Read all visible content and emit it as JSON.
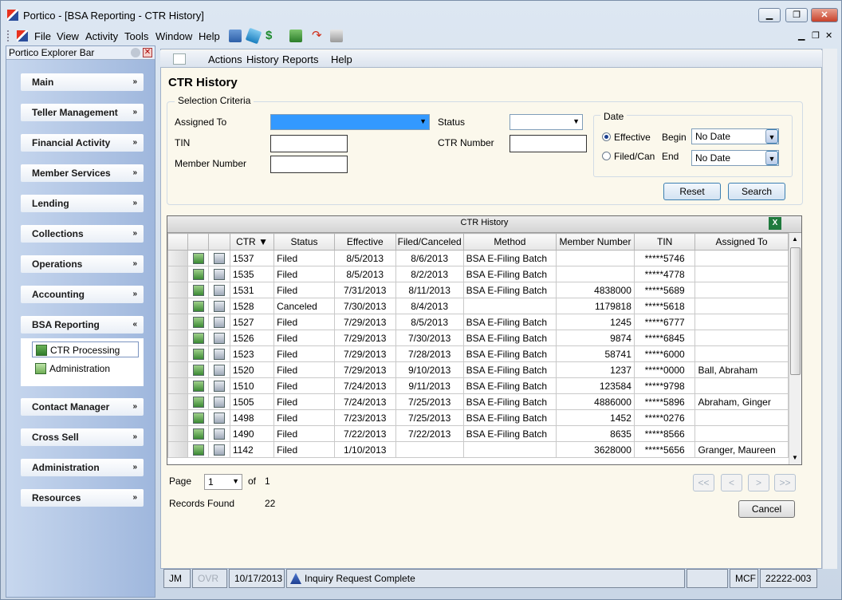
{
  "window": {
    "title": "Portico - [BSA Reporting - CTR History]"
  },
  "menu": [
    "File",
    "View",
    "Activity",
    "Tools",
    "Window",
    "Help"
  ],
  "explorer": {
    "title": "Portico Explorer Bar",
    "sections": [
      "Main",
      "Teller Management",
      "Financial Activity",
      "Member Services",
      "Lending",
      "Collections",
      "Operations",
      "Accounting",
      "BSA Reporting",
      "Contact Manager",
      "Cross Sell",
      "Administration",
      "Resources"
    ],
    "bsa_items": [
      "CTR Processing",
      "Administration"
    ]
  },
  "toolbar": {
    "actions": "Actions",
    "history": "History",
    "reports": "Reports",
    "help": "Help"
  },
  "page": {
    "title": "CTR History",
    "criteria_legend": "Selection Criteria",
    "assigned_to_label": "Assigned To",
    "tin_label": "TIN",
    "member_number_label": "Member Number",
    "status_label": "Status",
    "ctr_number_label": "CTR Number",
    "date_legend": "Date",
    "effective_label": "Effective",
    "filed_can_label": "Filed/Can",
    "begin_label": "Begin",
    "end_label": "End",
    "begin_value": "No Date",
    "end_value": "No Date",
    "reset": "Reset",
    "search": "Search"
  },
  "grid": {
    "title": "CTR History",
    "columns": [
      "CTR",
      "Status",
      "Effective",
      "Filed/Canceled",
      "Method",
      "Member Number",
      "TIN",
      "Assigned To"
    ],
    "rows": [
      [
        "1537",
        "Filed",
        "8/5/2013",
        "8/6/2013",
        "BSA E-Filing Batch",
        "",
        "*****5746",
        ""
      ],
      [
        "1535",
        "Filed",
        "8/5/2013",
        "8/2/2013",
        "BSA E-Filing Batch",
        "",
        "*****4778",
        ""
      ],
      [
        "1531",
        "Filed",
        "7/31/2013",
        "8/11/2013",
        "BSA E-Filing Batch",
        "4838000",
        "*****5689",
        ""
      ],
      [
        "1528",
        "Canceled",
        "7/30/2013",
        "8/4/2013",
        "",
        "1179818",
        "*****5618",
        ""
      ],
      [
        "1527",
        "Filed",
        "7/29/2013",
        "8/5/2013",
        "BSA E-Filing Batch",
        "1245",
        "*****6777",
        ""
      ],
      [
        "1526",
        "Filed",
        "7/29/2013",
        "7/30/2013",
        "BSA E-Filing Batch",
        "9874",
        "*****6845",
        ""
      ],
      [
        "1523",
        "Filed",
        "7/29/2013",
        "7/28/2013",
        "BSA E-Filing Batch",
        "58741",
        "*****6000",
        ""
      ],
      [
        "1520",
        "Filed",
        "7/29/2013",
        "9/10/2013",
        "BSA E-Filing Batch",
        "1237",
        "*****0000",
        "Ball, Abraham"
      ],
      [
        "1510",
        "Filed",
        "7/24/2013",
        "9/11/2013",
        "BSA E-Filing Batch",
        "123584",
        "*****9798",
        ""
      ],
      [
        "1505",
        "Filed",
        "7/24/2013",
        "7/25/2013",
        "BSA E-Filing Batch",
        "4886000",
        "*****5896",
        "Abraham, Ginger"
      ],
      [
        "1498",
        "Filed",
        "7/23/2013",
        "7/25/2013",
        "BSA E-Filing Batch",
        "1452",
        "*****0276",
        ""
      ],
      [
        "1490",
        "Filed",
        "7/22/2013",
        "7/22/2013",
        "BSA E-Filing Batch",
        "8635",
        "*****8566",
        ""
      ],
      [
        "1142",
        "Filed",
        "1/10/2013",
        "",
        "",
        "3628000",
        "*****5656",
        "Granger, Maureen"
      ]
    ]
  },
  "paging": {
    "page_label": "Page",
    "page_value": "1",
    "of_label": "of",
    "total_pages": "1",
    "records_label": "Records Found",
    "records_value": "22",
    "first": "<<",
    "prev": "<",
    "next": ">",
    "last": ">>",
    "cancel": "Cancel"
  },
  "status": {
    "user": "JM",
    "ovr": "OVR",
    "date": "10/17/2013",
    "message": "Inquiry Request Complete",
    "branch": "MCF",
    "code": "22222-003"
  }
}
